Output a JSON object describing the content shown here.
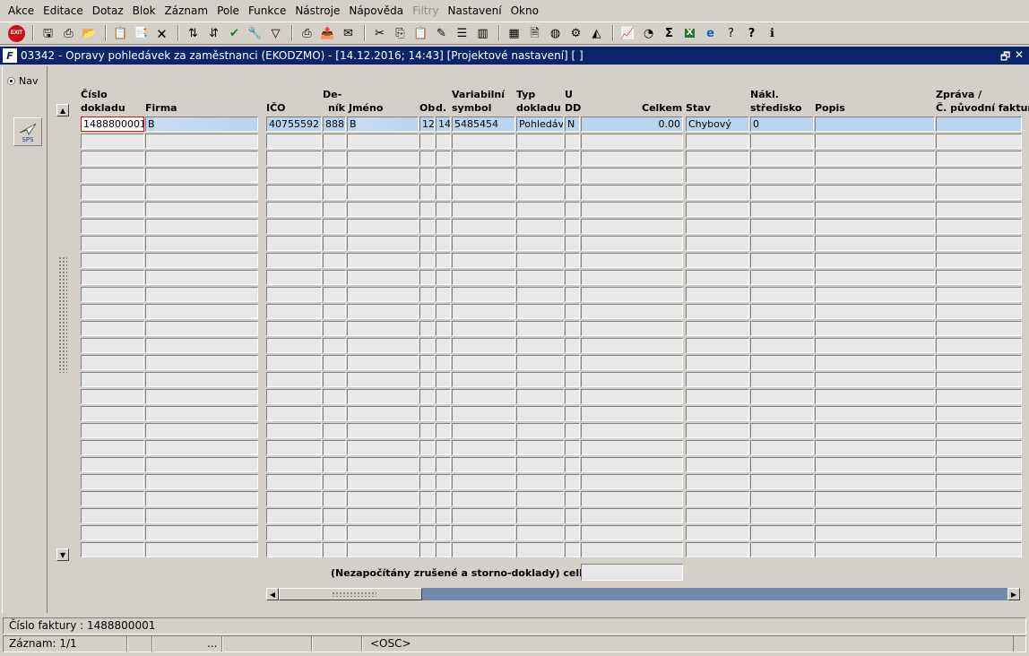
{
  "menu": {
    "items": [
      {
        "label": "Akce",
        "disabled": false
      },
      {
        "label": "Editace",
        "disabled": false
      },
      {
        "label": "Dotaz",
        "disabled": false
      },
      {
        "label": "Blok",
        "disabled": false
      },
      {
        "label": "Záznam",
        "disabled": false
      },
      {
        "label": "Pole",
        "disabled": false
      },
      {
        "label": "Funkce",
        "disabled": false
      },
      {
        "label": "Nástroje",
        "disabled": false
      },
      {
        "label": "Nápověda",
        "disabled": false
      },
      {
        "label": "Filtry",
        "disabled": true
      },
      {
        "label": "Nastavení",
        "disabled": false
      },
      {
        "label": "Okno",
        "disabled": false
      }
    ]
  },
  "toolbar": {
    "exit_label": "EXIT",
    "icons": [
      "save-icon",
      "print-icon",
      "folder-icon",
      "sep",
      "query-enter-icon",
      "query-execute-icon",
      "query-cancel-icon",
      "sep",
      "sort-asc-icon",
      "sort-desc-icon",
      "check-icon",
      "wrench-icon",
      "filter-icon",
      "sep",
      "printer-icon",
      "export-icon",
      "mail-icon",
      "sep",
      "cut-icon",
      "copy-icon",
      "paste-icon",
      "edit-icon",
      "list-icon",
      "columns-icon",
      "sep",
      "calculator-icon",
      "note-icon",
      "globe-icon",
      "gear-icon",
      "chart-icon",
      "sep",
      "report-icon",
      "clock-icon",
      "sum-icon",
      "excel-icon",
      "explorer-icon",
      "help-search-icon",
      "help-icon",
      "info-icon"
    ],
    "sum_glyph": "Σ",
    "help_glyph": "?"
  },
  "window": {
    "logo": "F",
    "title": "03342 - Opravy pohledávek za zaměstnanci (EKODZMO) - [14.12.2016; 14:43]  [Projektové nastavení]  [ ]",
    "restore_glyph": "🗗",
    "close_glyph": "✕"
  },
  "left_panel": {
    "nav_label": "Nav",
    "sps_label": "SPS"
  },
  "grid": {
    "headers": [
      {
        "line1": "Číslo",
        "line2": "dokladu"
      },
      {
        "line1": "",
        "line2": "Firma"
      },
      {
        "line1": "",
        "line2": "IČO"
      },
      {
        "line1": "De-",
        "line2": "ník"
      },
      {
        "line1": "",
        "line2": "Jméno"
      },
      {
        "line1": "",
        "line2": "Ob"
      },
      {
        "line1": "",
        "line2": "d."
      },
      {
        "line1": "Variabilní",
        "line2": "symbol"
      },
      {
        "line1": "Typ",
        "line2": "dokladu"
      },
      {
        "line1": "U",
        "line2": "DD"
      },
      {
        "line1": "",
        "line2": "Celkem"
      },
      {
        "line1": "",
        "line2": "Stav"
      },
      {
        "line1": "Nákl.",
        "line2": "středisko"
      },
      {
        "line1": "",
        "line2": "Popis"
      },
      {
        "line1": "Zpráva /",
        "line2": "Č. původní faktury"
      }
    ],
    "first_row": [
      "1488800001",
      "B",
      "40755592",
      "888",
      "B",
      "12",
      "14",
      "5485454",
      "Pohledávka",
      "N",
      "0.00",
      "Chybový",
      "0",
      "",
      ""
    ],
    "row_count": 26
  },
  "totals": {
    "label": "(Nezapočítány zrušené a storno-doklady) celkem",
    "value": ""
  },
  "status": {
    "line1": "Číslo faktury : 1488800001",
    "record": "Záznam: 1/1",
    "seg_dots": "...",
    "mode": "<OSC>"
  }
}
